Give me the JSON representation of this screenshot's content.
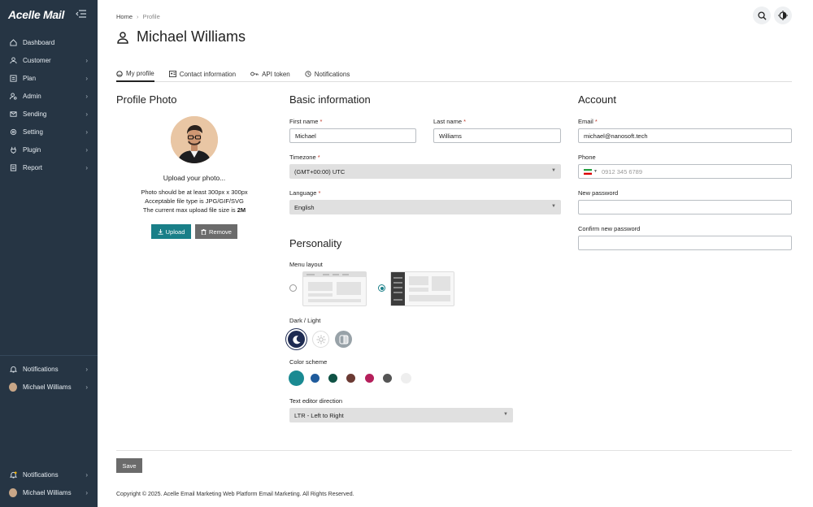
{
  "sidebar": {
    "logo": "Acelle Mail",
    "items": [
      {
        "label": "Dashboard",
        "icon": "home-icon",
        "chevron": false
      },
      {
        "label": "Customer",
        "icon": "user-icon",
        "chevron": true
      },
      {
        "label": "Plan",
        "icon": "plan-icon",
        "chevron": true
      },
      {
        "label": "Admin",
        "icon": "admin-icon",
        "chevron": true
      },
      {
        "label": "Sending",
        "icon": "send-icon",
        "chevron": true
      },
      {
        "label": "Setting",
        "icon": "gear-icon",
        "chevron": true
      },
      {
        "label": "Plugin",
        "icon": "plugin-icon",
        "chevron": true
      },
      {
        "label": "Report",
        "icon": "report-icon",
        "chevron": true
      }
    ],
    "bottom1": {
      "notifications": "Notifications",
      "user": "Michael Williams"
    },
    "bottom2": {
      "notifications": "Notifications",
      "user": "Michael Williams"
    }
  },
  "breadcrumb": {
    "home": "Home",
    "separator": "›",
    "current": "Profile"
  },
  "page": {
    "title": "Michael Williams"
  },
  "tabs": [
    {
      "label": "My profile",
      "icon": "smile-icon"
    },
    {
      "label": "Contact information",
      "icon": "contact-card-icon"
    },
    {
      "label": "API token",
      "icon": "key-icon"
    },
    {
      "label": "Notifications",
      "icon": "history-icon"
    }
  ],
  "profile_photo": {
    "title": "Profile Photo",
    "upload_heading": "Upload your photo...",
    "line1": "Photo should be at least 300px x 300px",
    "line2": "Acceptable file type is JPG/GIF/SVG",
    "line3_prefix": "The current max upload file size is ",
    "line3_value": "2M",
    "upload_label": "Upload",
    "remove_label": "Remove"
  },
  "basic": {
    "title": "Basic information",
    "first_name_label": "First name",
    "first_name": "Michael",
    "last_name_label": "Last name",
    "last_name": "Williams",
    "timezone_label": "Timezone",
    "timezone": "(GMT+00:00) UTC",
    "language_label": "Language",
    "language": "English",
    "required_mark": "*"
  },
  "personality": {
    "title": "Personality",
    "menu_layout_label": "Menu layout",
    "dark_light_label": "Dark / Light",
    "color_scheme_label": "Color scheme",
    "colors": [
      "#1a8a92",
      "#1f5b9c",
      "#0f5245",
      "#6b3a33",
      "#b51f5b",
      "#555555",
      "#eeeeee"
    ],
    "text_direction_label": "Text editor direction",
    "text_direction": "LTR - Left to Right"
  },
  "account": {
    "title": "Account",
    "email_label": "Email",
    "email": "michael@nanosoft.tech",
    "phone_label": "Phone",
    "phone_placeholder": "0912 345 6789",
    "new_password_label": "New password",
    "confirm_password_label": "Confirm new password"
  },
  "actions": {
    "save_label": "Save"
  },
  "footer": {
    "copyright": "Copyright © 2025. Acelle Email Marketing Web Platform Email Marketing. All Rights Reserved."
  }
}
